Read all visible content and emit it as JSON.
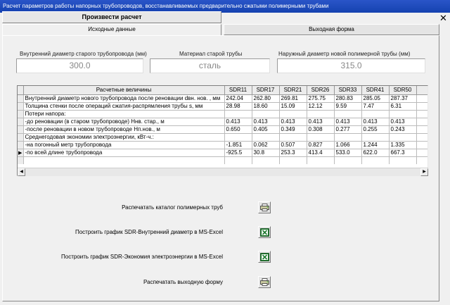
{
  "window": {
    "title": "Расчет параметров работы напорных трубопроводов, восстанавливаемых предварительно сжатыми полимерными трубами"
  },
  "toolbar": {
    "calc_label": "Произвести расчет"
  },
  "tabs": [
    {
      "label": "Исходные данные"
    },
    {
      "label": "Выходная форма"
    }
  ],
  "inputs": {
    "inner_diameter": {
      "label": "Внутренний диаметр старого трубопровода (мм)",
      "value": "300.0"
    },
    "material": {
      "label": "Материал старой трубы",
      "value": "сталь"
    },
    "outer_diameter": {
      "label": "Наружный диаметр новой полимерной трубы (мм)",
      "value": "315.0"
    }
  },
  "grid": {
    "columns": [
      "Расчетные величины",
      "SDR11",
      "SDR17",
      "SDR21",
      "SDR26",
      "SDR33",
      "SDR41",
      "SDR50"
    ],
    "rows": [
      {
        "marker": "",
        "cells": [
          "Внутренний диаметр нового трубопровода после реновации dвн. нов. , мм",
          "242.04",
          "262.80",
          "269.81",
          "275.75",
          "280.83",
          "285.05",
          "287.37"
        ]
      },
      {
        "marker": "",
        "cells": [
          "Толщина стенки после операций сжатия-распрямления трубы s, мм",
          "28.98",
          "18.60",
          "15.09",
          "12.12",
          "9.59",
          "7.47",
          "6.31"
        ]
      },
      {
        "marker": "",
        "cells": [
          "Потери напора:",
          "",
          "",
          "",
          "",
          "",
          "",
          ""
        ]
      },
      {
        "marker": "",
        "cells": [
          "-до реновации (в старом трубопроводе) Ннв. стар., м",
          "0.413",
          "0.413",
          "0.413",
          "0.413",
          "0.413",
          "0.413",
          "0.413"
        ]
      },
      {
        "marker": "",
        "cells": [
          "-после реновации в новом трубопроводе Нп.нов., м",
          "0.650",
          "0.405",
          "0.349",
          "0.308",
          "0.277",
          "0.255",
          "0.243"
        ]
      },
      {
        "marker": "",
        "cells": [
          "Среднегодовая экономии электроэнергии,  кВт-ч.:",
          "",
          "",
          "",
          "",
          "",
          "",
          ""
        ]
      },
      {
        "marker": "",
        "cells": [
          "-на погонный метр трубопровода",
          "-1.851",
          "0.062",
          "0.507",
          "0.827",
          "1.066",
          "1.244",
          "1.335"
        ]
      },
      {
        "marker": "▶",
        "cells": [
          "-по всей длине трубопровода",
          "-925.5",
          "30.8",
          "253.3",
          "413.4",
          "533.0",
          "622.0",
          "667.3"
        ]
      }
    ]
  },
  "actions": [
    {
      "label": "Распечатать каталог полимерных труб",
      "icon": "printer-icon"
    },
    {
      "label": "Построить график SDR-Внутренний диаметр в MS-Excel",
      "icon": "excel-icon"
    },
    {
      "label": "Построить график SDR-Экономия электроэнергии  в MS-Excel",
      "icon": "excel-icon"
    },
    {
      "label": "Распечатать выходную форму",
      "icon": "printer-icon"
    }
  ]
}
